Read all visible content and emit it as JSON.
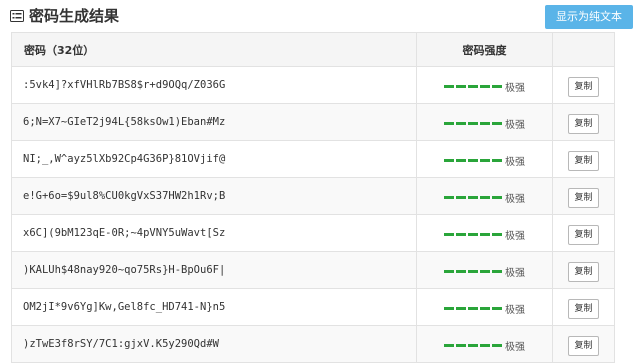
{
  "header": {
    "title": "密码生成结果",
    "plain_text_button": "显示为纯文本",
    "title_icon": "list-icon"
  },
  "table": {
    "columns": {
      "password": "密码（32位）",
      "strength": "密码强度",
      "action": ""
    },
    "rows": [
      {
        "password": ":5vk4]?xfVHlRb7BS8$r+d9OQq/Z036G",
        "strength": "极强",
        "strength_level": 5,
        "copy_label": "复制"
      },
      {
        "password": "6;N=X7~GIeT2j94L{58ksOw1)Eban#Mz",
        "strength": "极强",
        "strength_level": 5,
        "copy_label": "复制"
      },
      {
        "password": "NI;_,W^ayz5lXb92Cp4G36P}81OVjif@",
        "strength": "极强",
        "strength_level": 5,
        "copy_label": "复制"
      },
      {
        "password": "e!G+6o=$9ul8%CU0kgVxS37HW2h1Rv;B",
        "strength": "极强",
        "strength_level": 5,
        "copy_label": "复制"
      },
      {
        "password": "x6C](9bM123qE-0R;~4pVNY5uWavt[Sz",
        "strength": "极强",
        "strength_level": 5,
        "copy_label": "复制"
      },
      {
        "password": ")KALUh$48nay920~qo75Rs}H-BpOu6F|",
        "strength": "极强",
        "strength_level": 5,
        "copy_label": "复制"
      },
      {
        "password": "OM2jI*9v6Yg]Kw,Gel8fc_HD741-N}n5",
        "strength": "极强",
        "strength_level": 5,
        "copy_label": "复制"
      },
      {
        "password": ")zTwE3f8rSY/7C1:gjxV.K5y290Qd#W",
        "strength": "极强",
        "strength_level": 5,
        "copy_label": "复制"
      }
    ]
  },
  "colors": {
    "accent": "#5ab4e8",
    "strength_bar": "#2aa53a"
  }
}
